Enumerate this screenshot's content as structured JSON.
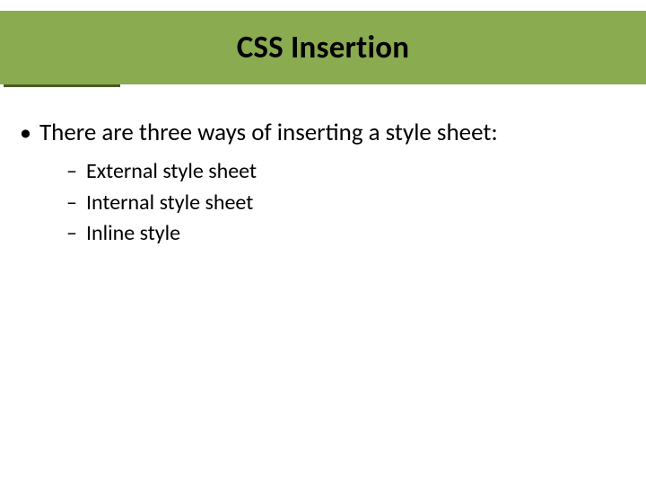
{
  "slide": {
    "title": "CSS Insertion",
    "bullets": {
      "main": "There are three ways of inserting a style sheet:",
      "sub": [
        "External style sheet",
        "Internal style sheet",
        "Inline style"
      ]
    }
  },
  "colors": {
    "band": "#8aab4f",
    "accent": "#4a5a2a"
  }
}
